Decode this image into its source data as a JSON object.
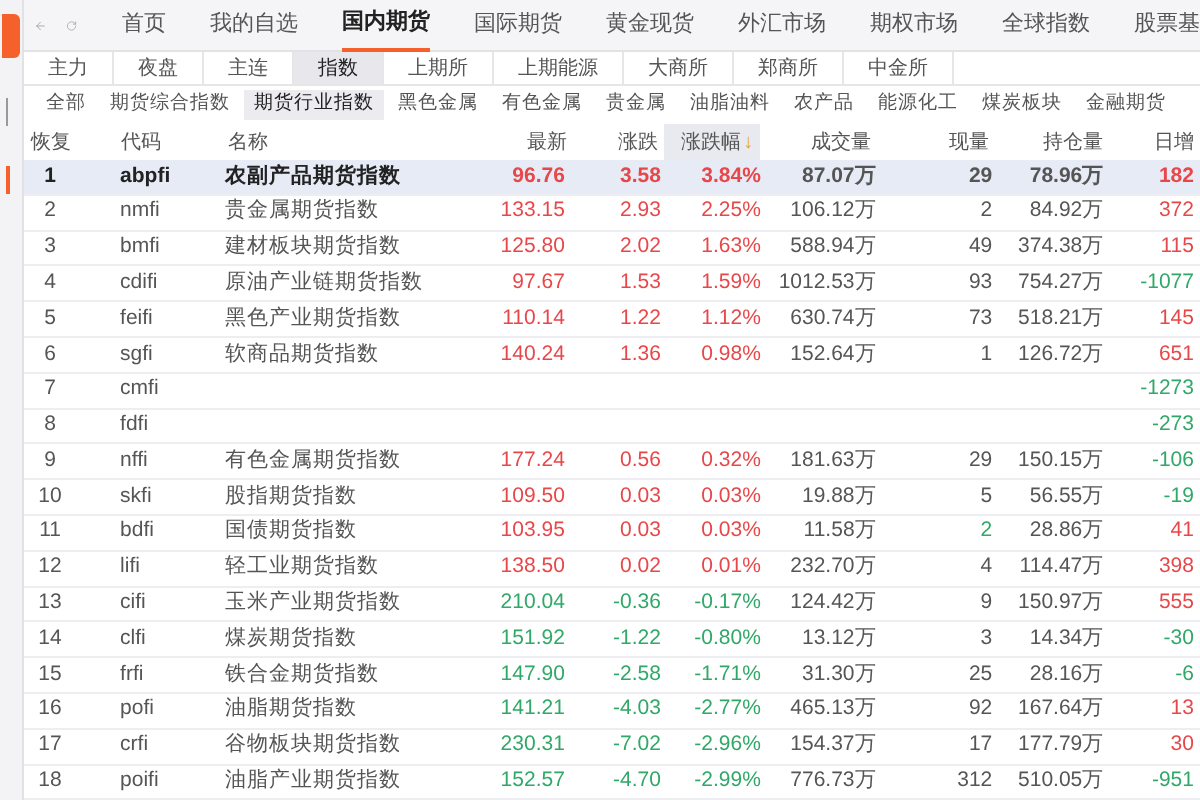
{
  "nav": {
    "tabs": [
      {
        "label": "首页",
        "selected": false
      },
      {
        "label": "我的自选",
        "selected": false
      },
      {
        "label": "国内期货",
        "selected": true
      },
      {
        "label": "国际期货",
        "selected": false
      },
      {
        "label": "黄金现货",
        "selected": false
      },
      {
        "label": "外汇市场",
        "selected": false
      },
      {
        "label": "期权市场",
        "selected": false
      },
      {
        "label": "全球指数",
        "selected": false
      },
      {
        "label": "股票基",
        "selected": false
      }
    ]
  },
  "market_tabs": [
    {
      "label": "主力",
      "selected": false
    },
    {
      "label": "夜盘",
      "selected": false
    },
    {
      "label": "主连",
      "selected": false
    },
    {
      "label": "指数",
      "selected": true
    },
    {
      "label": "上期所",
      "selected": false
    },
    {
      "label": "上期能源",
      "selected": false
    },
    {
      "label": "大商所",
      "selected": false
    },
    {
      "label": "郑商所",
      "selected": false
    },
    {
      "label": "中金所",
      "selected": false
    }
  ],
  "category_tabs": [
    {
      "label": "全部",
      "selected": false
    },
    {
      "label": "期货综合指数",
      "selected": false
    },
    {
      "label": "期货行业指数",
      "selected": true
    },
    {
      "label": "黑色金属",
      "selected": false
    },
    {
      "label": "有色金属",
      "selected": false
    },
    {
      "label": "贵金属",
      "selected": false
    },
    {
      "label": "油脂油料",
      "selected": false
    },
    {
      "label": "农产品",
      "selected": false
    },
    {
      "label": "能源化工",
      "selected": false
    },
    {
      "label": "煤炭板块",
      "selected": false
    },
    {
      "label": "金融期货",
      "selected": false
    }
  ],
  "table": {
    "columns": [
      "恢复",
      "代码",
      "名称",
      "最新",
      "涨跌",
      "涨跌幅",
      "成交量",
      "现量",
      "持仓量",
      "日增"
    ],
    "sort_mark": "↓",
    "rows": [
      {
        "selected": true,
        "rising": true,
        "cur_falling": false,
        "daily_rising": true,
        "no": "1",
        "code": "abpfi",
        "name": "农副产品期货指数",
        "last": "96.76",
        "change": "3.58",
        "pct": "3.84%",
        "volume": "87.07万",
        "cur": "29",
        "oi": "78.96万",
        "daily": "182"
      },
      {
        "selected": false,
        "rising": true,
        "cur_falling": false,
        "daily_rising": true,
        "no": "2",
        "code": "nmfi",
        "name": "贵金属期货指数",
        "last": "133.15",
        "change": "2.93",
        "pct": "2.25%",
        "volume": "106.12万",
        "cur": "2",
        "oi": "84.92万",
        "daily": "372"
      },
      {
        "selected": false,
        "rising": true,
        "cur_falling": false,
        "daily_rising": true,
        "no": "3",
        "code": "bmfi",
        "name": "建材板块期货指数",
        "last": "125.80",
        "change": "2.02",
        "pct": "1.63%",
        "volume": "588.94万",
        "cur": "49",
        "oi": "374.38万",
        "daily": "115"
      },
      {
        "selected": false,
        "rising": true,
        "cur_falling": false,
        "daily_rising": false,
        "no": "4",
        "code": "cdifi",
        "name": "原油产业链期货指数",
        "last": "97.67",
        "change": "1.53",
        "pct": "1.59%",
        "volume": "1012.53万",
        "cur": "93",
        "oi": "754.27万",
        "daily": "-1077"
      },
      {
        "selected": false,
        "rising": true,
        "cur_falling": false,
        "daily_rising": true,
        "no": "5",
        "code": "feifi",
        "name": "黑色产业期货指数",
        "last": "110.14",
        "change": "1.22",
        "pct": "1.12%",
        "volume": "630.74万",
        "cur": "73",
        "oi": "518.21万",
        "daily": "145"
      },
      {
        "selected": false,
        "rising": true,
        "cur_falling": false,
        "daily_rising": true,
        "no": "6",
        "code": "sgfi",
        "name": "软商品期货指数",
        "last": "140.24",
        "change": "1.36",
        "pct": "0.98%",
        "volume": "152.64万",
        "cur": "1",
        "oi": "126.72万",
        "daily": "651"
      },
      {
        "selected": false,
        "daily_rising": false,
        "no": "7",
        "code": "cmfi",
        "daily": "-1273"
      },
      {
        "selected": false,
        "daily_rising": false,
        "no": "8",
        "code": "fdfi",
        "daily": "-273"
      },
      {
        "selected": false,
        "rising": true,
        "cur_falling": false,
        "daily_rising": false,
        "no": "9",
        "code": "nffi",
        "name": "有色金属期货指数",
        "last": "177.24",
        "change": "0.56",
        "pct": "0.32%",
        "volume": "181.63万",
        "cur": "29",
        "oi": "150.15万",
        "daily": "-106"
      },
      {
        "selected": false,
        "rising": true,
        "cur_falling": false,
        "daily_rising": false,
        "no": "10",
        "code": "skfi",
        "name": "股指期货指数",
        "last": "109.50",
        "change": "0.03",
        "pct": "0.03%",
        "volume": "19.88万",
        "cur": "5",
        "oi": "56.55万",
        "daily": "-19"
      },
      {
        "selected": false,
        "rising": true,
        "cur_falling": true,
        "daily_rising": true,
        "no": "11",
        "code": "bdfi",
        "name": "国债期货指数",
        "last": "103.95",
        "change": "0.03",
        "pct": "0.03%",
        "volume": "11.58万",
        "cur": "2",
        "oi": "28.86万",
        "daily": "41"
      },
      {
        "selected": false,
        "rising": true,
        "cur_falling": false,
        "daily_rising": true,
        "no": "12",
        "code": "lifi",
        "name": "轻工业期货指数",
        "last": "138.50",
        "change": "0.02",
        "pct": "0.01%",
        "volume": "232.70万",
        "cur": "4",
        "oi": "114.47万",
        "daily": "398"
      },
      {
        "selected": false,
        "rising": false,
        "cur_falling": false,
        "daily_rising": true,
        "no": "13",
        "code": "cifi",
        "name": "玉米产业期货指数",
        "last": "210.04",
        "change": "-0.36",
        "pct": "-0.17%",
        "volume": "124.42万",
        "cur": "9",
        "oi": "150.97万",
        "daily": "555"
      },
      {
        "selected": false,
        "rising": false,
        "cur_falling": false,
        "daily_rising": false,
        "no": "14",
        "code": "clfi",
        "name": "煤炭期货指数",
        "last": "151.92",
        "change": "-1.22",
        "pct": "-0.80%",
        "volume": "13.12万",
        "cur": "3",
        "oi": "14.34万",
        "daily": "-30"
      },
      {
        "selected": false,
        "rising": false,
        "cur_falling": false,
        "daily_rising": false,
        "no": "15",
        "code": "frfi",
        "name": "铁合金期货指数",
        "last": "147.90",
        "change": "-2.58",
        "pct": "-1.71%",
        "volume": "31.30万",
        "cur": "25",
        "oi": "28.16万",
        "daily": "-6"
      },
      {
        "selected": false,
        "rising": false,
        "cur_falling": false,
        "daily_rising": true,
        "no": "16",
        "code": "pofi",
        "name": "油脂期货指数",
        "last": "141.21",
        "change": "-4.03",
        "pct": "-2.77%",
        "volume": "465.13万",
        "cur": "92",
        "oi": "167.64万",
        "daily": "13"
      },
      {
        "selected": false,
        "rising": false,
        "cur_falling": false,
        "daily_rising": true,
        "no": "17",
        "code": "crfi",
        "name": "谷物板块期货指数",
        "last": "230.31",
        "change": "-7.02",
        "pct": "-2.96%",
        "volume": "154.37万",
        "cur": "17",
        "oi": "177.79万",
        "daily": "30"
      },
      {
        "selected": false,
        "rising": false,
        "cur_falling": false,
        "daily_rising": false,
        "no": "18",
        "code": "poifi",
        "name": "油脂产业期货指数",
        "last": "152.57",
        "change": "-4.70",
        "pct": "-2.99%",
        "volume": "776.73万",
        "cur": "312",
        "oi": "510.05万",
        "daily": "-951"
      }
    ]
  }
}
